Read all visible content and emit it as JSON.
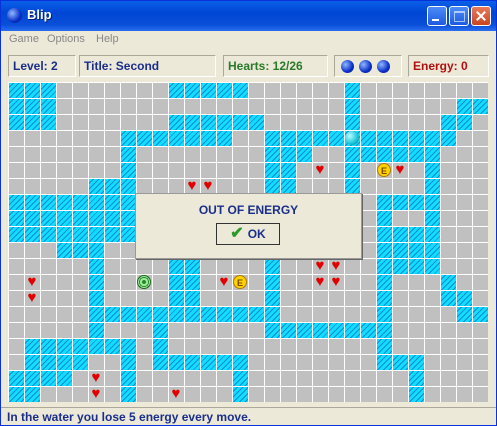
{
  "window": {
    "title": "Blip"
  },
  "menu": [
    "Game",
    "Options",
    "Help"
  ],
  "status": {
    "level": "Level: 2",
    "title": "Title: Second",
    "hearts": "Hearts: 12/26",
    "lives": 3,
    "energy": "Energy: 0"
  },
  "board": {
    "cols": 30,
    "rows": 20,
    "cell_size": 16,
    "water": [
      [
        0,
        0,
        3
      ],
      [
        10,
        0,
        5
      ],
      [
        21,
        0,
        1
      ],
      [
        0,
        1,
        3
      ],
      [
        21,
        1,
        1
      ],
      [
        28,
        1,
        2
      ],
      [
        0,
        2,
        3
      ],
      [
        10,
        2,
        6
      ],
      [
        21,
        2,
        1
      ],
      [
        27,
        2,
        2
      ],
      [
        7,
        3,
        7
      ],
      [
        16,
        3,
        12
      ],
      [
        7,
        4,
        1
      ],
      [
        16,
        4,
        3
      ],
      [
        21,
        4,
        6
      ],
      [
        7,
        5,
        1
      ],
      [
        16,
        5,
        2
      ],
      [
        21,
        5,
        1
      ],
      [
        26,
        5,
        1
      ],
      [
        5,
        6,
        3
      ],
      [
        16,
        6,
        2
      ],
      [
        21,
        6,
        1
      ],
      [
        26,
        6,
        1
      ],
      [
        0,
        7,
        8
      ],
      [
        16,
        7,
        1
      ],
      [
        23,
        7,
        3
      ],
      [
        26,
        7,
        1
      ],
      [
        0,
        8,
        8
      ],
      [
        16,
        8,
        1
      ],
      [
        23,
        8,
        1
      ],
      [
        26,
        8,
        1
      ],
      [
        0,
        9,
        8
      ],
      [
        16,
        9,
        1
      ],
      [
        23,
        9,
        4
      ],
      [
        3,
        10,
        3
      ],
      [
        16,
        10,
        1
      ],
      [
        23,
        10,
        4
      ],
      [
        5,
        11,
        1
      ],
      [
        10,
        11,
        2
      ],
      [
        16,
        11,
        1
      ],
      [
        23,
        11,
        4
      ],
      [
        5,
        12,
        1
      ],
      [
        10,
        12,
        2
      ],
      [
        16,
        12,
        1
      ],
      [
        23,
        12,
        1
      ],
      [
        27,
        12,
        1
      ],
      [
        5,
        13,
        1
      ],
      [
        10,
        13,
        2
      ],
      [
        16,
        13,
        1
      ],
      [
        23,
        13,
        1
      ],
      [
        27,
        13,
        2
      ],
      [
        5,
        14,
        11
      ],
      [
        16,
        14,
        1
      ],
      [
        23,
        14,
        1
      ],
      [
        28,
        14,
        2
      ],
      [
        5,
        15,
        1
      ],
      [
        9,
        15,
        1
      ],
      [
        16,
        15,
        8
      ],
      [
        1,
        16,
        6
      ],
      [
        7,
        16,
        1
      ],
      [
        9,
        16,
        1
      ],
      [
        23,
        16,
        1
      ],
      [
        1,
        17,
        4
      ],
      [
        7,
        17,
        1
      ],
      [
        9,
        17,
        6
      ],
      [
        23,
        17,
        3
      ],
      [
        0,
        18,
        4
      ],
      [
        7,
        18,
        1
      ],
      [
        14,
        18,
        1
      ],
      [
        25,
        18,
        1
      ],
      [
        0,
        19,
        2
      ],
      [
        7,
        19,
        1
      ],
      [
        14,
        19,
        1
      ],
      [
        25,
        19,
        1
      ]
    ],
    "hearts": [
      [
        11,
        6
      ],
      [
        12,
        6
      ],
      [
        19,
        5
      ],
      [
        24,
        5
      ],
      [
        1,
        12
      ],
      [
        1,
        13
      ],
      [
        13,
        12
      ],
      [
        19,
        11
      ],
      [
        20,
        11
      ],
      [
        19,
        12
      ],
      [
        20,
        12
      ],
      [
        5,
        18
      ],
      [
        5,
        19
      ],
      [
        10,
        19
      ]
    ],
    "energy_pickups": [
      [
        23,
        5
      ],
      [
        14,
        12
      ]
    ],
    "energy_label": "E",
    "target": [
      8,
      12
    ],
    "player": [
      21,
      3
    ]
  },
  "dialog": {
    "message": "OUT OF ENERGY",
    "ok_label": "OK"
  },
  "hint": "In the water you lose 5 energy every move.",
  "colors": {
    "water": "#14dcff",
    "floor": "#c0c0c0",
    "heart": "#e00000",
    "text": "#1a2e8a"
  }
}
